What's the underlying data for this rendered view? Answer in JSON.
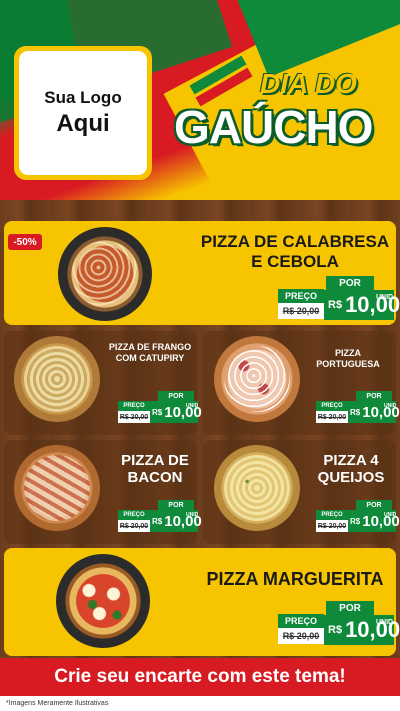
{
  "logo": {
    "line1": "Sua Logo",
    "line2": "Aqui"
  },
  "title": {
    "line1": "DIA DO",
    "line2": "GAÚCHO"
  },
  "price_labels": {
    "por": "POR",
    "preco": "PREÇO",
    "currency": "R$",
    "unit": "UNID"
  },
  "products": [
    {
      "name": "PIZZA DE CALABRESA E CEBOLA",
      "discount": "-50%",
      "old_price": "R$ 20,00",
      "price": "10,00"
    },
    {
      "name": "PIZZA DE FRANGO COM CATUPIRY",
      "old_price": "R$ 20,00",
      "price": "10,00"
    },
    {
      "name": "PIZZA PORTUGUESA",
      "old_price": "R$ 20,00",
      "price": "10,00"
    },
    {
      "name": "PIZZA DE BACON",
      "old_price": "R$ 20,00",
      "price": "10,00"
    },
    {
      "name": "PIZZA 4 QUEIJOS",
      "old_price": "R$ 20,00",
      "price": "10,00"
    },
    {
      "name": "PIZZA MARGUERITA",
      "old_price": "R$ 20,00",
      "price": "10,00"
    }
  ],
  "cta": "Crie seu encarte com este tema!",
  "disclaimer": "*Imagens Meramente Ilustrativas",
  "colors": {
    "green": "#0e8a3a",
    "red": "#d81b22",
    "yellow": "#f6c500",
    "wood": "#6b3d1d"
  }
}
